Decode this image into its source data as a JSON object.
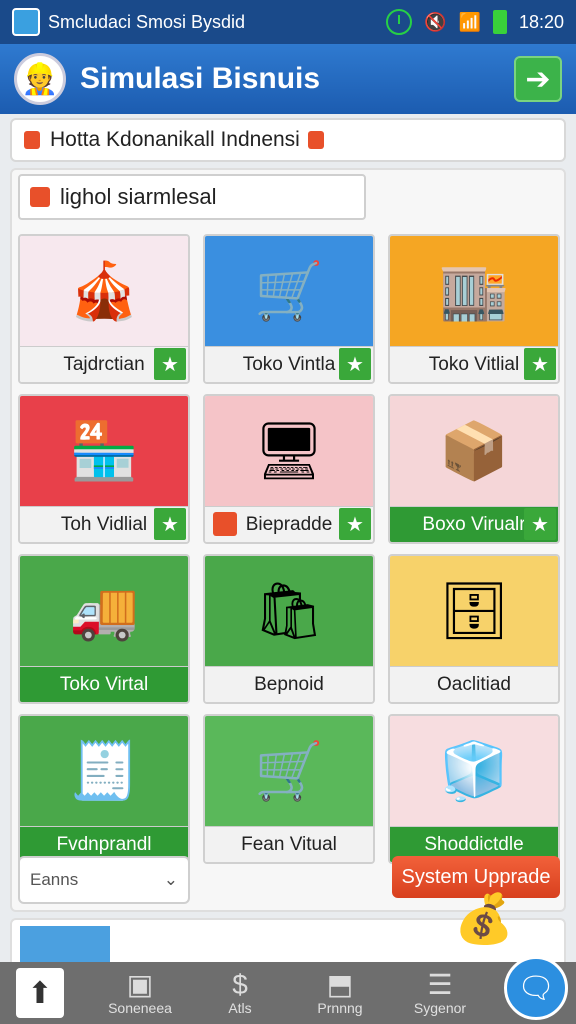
{
  "status_bar": {
    "title": "Smcludaci Smosi Bysdid",
    "time": "18:20"
  },
  "app_bar": {
    "title": "Simulasi Bisnuis"
  },
  "notice": {
    "text": "Hotta Kdonanikall Indnensi"
  },
  "search": {
    "value": "lighol siarmlesal"
  },
  "tiles": [
    {
      "label": "Tajdrctian",
      "art": "🎪",
      "bg": "#f7e8ee"
    },
    {
      "label": "Toko Vintla",
      "art": "🛒",
      "bg": "#3a8fe0"
    },
    {
      "label": "Toko Vitlial",
      "art": "🏬",
      "bg": "#f5a623"
    },
    {
      "label": "Toh Vidlial",
      "art": "🏪",
      "bg": "#e8404a"
    },
    {
      "label": "Biepradde",
      "art": "🖥",
      "bg": "#f5c4c8"
    },
    {
      "label": "Boxo Virualr",
      "art": "📦",
      "bg": "#f5d6d8"
    },
    {
      "label": "Toko Virtal",
      "art": "🚚",
      "bg": "#4aa84a"
    },
    {
      "label": "Bepnoid",
      "art": "🛍",
      "bg": "#4aa84a"
    },
    {
      "label": "Oaclitiad",
      "art": "🗄",
      "bg": "#f7d26a"
    },
    {
      "label": "Fvdnprandl",
      "art": "🧾",
      "bg": "#4aa84a"
    },
    {
      "label": "Fean Vitual",
      "art": "🛒",
      "bg": "#5ab85a"
    },
    {
      "label": "Shoddictdle",
      "art": "🧊",
      "bg": "#f7dde0"
    }
  ],
  "dropdown": {
    "value": "Eanns"
  },
  "upgrade_button": {
    "label": "System Upprade"
  },
  "nav": {
    "items": [
      {
        "label": "Soneneea",
        "icon": "▣"
      },
      {
        "label": "Atls",
        "icon": "$"
      },
      {
        "label": "Prnnng",
        "icon": "⬒"
      },
      {
        "label": "Sygenor",
        "icon": "☰"
      }
    ]
  }
}
